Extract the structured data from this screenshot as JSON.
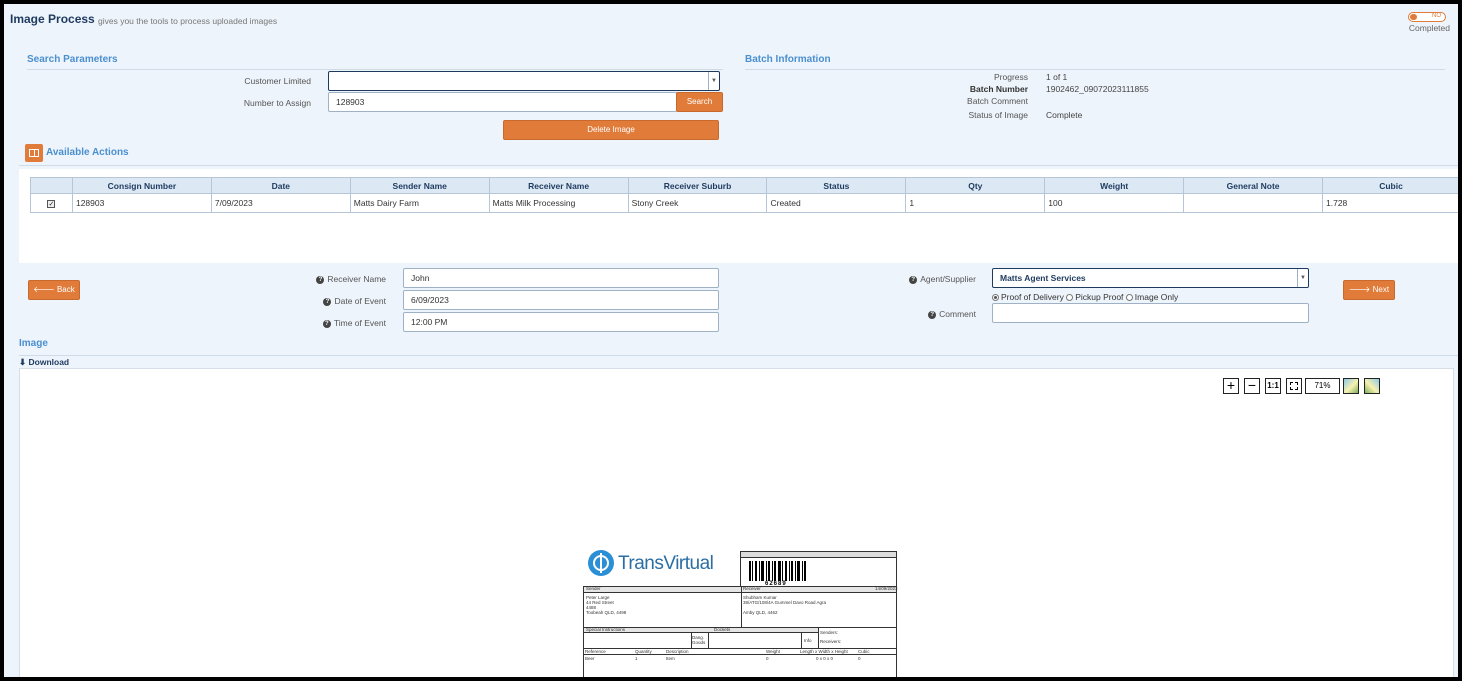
{
  "header": {
    "title": "Image Process",
    "subtitle": "gives you the tools to process uploaded images",
    "skip_line1": "Skip",
    "skip_line2": "Completed",
    "toggle_state": "NO"
  },
  "search": {
    "section_title": "Search Parameters",
    "customer_label": "Customer Limited",
    "customer_value": "",
    "number_label": "Number to Assign",
    "number_value": "128903",
    "search_button": "Search",
    "delete_button": "Delete Image"
  },
  "batch": {
    "section_title": "Batch Information",
    "progress_label": "Progress",
    "progress_value": "1 of 1",
    "batch_number_label": "Batch Number",
    "batch_number_value": "1902462_09072023111855",
    "batch_comment_label": "Batch Comment",
    "batch_comment_value": "",
    "status_label": "Status of Image",
    "status_value": "Complete"
  },
  "actions": {
    "section_title": "Available Actions",
    "columns": [
      "Consign Number",
      "Date",
      "Sender Name",
      "Receiver Name",
      "Receiver Suburb",
      "Status",
      "Qty",
      "Weight",
      "General Note",
      "Cubic"
    ],
    "rows": [
      {
        "checked": true,
        "cells": [
          "128903",
          "7/09/2023",
          "Matts Dairy Farm",
          "Matts Milk Processing",
          "Stony Creek",
          "Created",
          "1",
          "100",
          "",
          "1.728"
        ]
      }
    ]
  },
  "event": {
    "back_button": "Back",
    "next_button": "Next",
    "receiver_name_label": "Receiver Name",
    "receiver_name_value": "John",
    "date_label": "Date of Event",
    "date_value": "6/09/2023",
    "time_label": "Time of Event",
    "time_value": "12:00 PM",
    "agent_label": "Agent/Supplier",
    "agent_value": "Matts Agent Services",
    "radio_options": [
      "Proof of Delivery",
      "Pickup Proof",
      "Image Only"
    ],
    "radio_selected": "Proof of Delivery",
    "comment_label": "Comment",
    "comment_value": ""
  },
  "image": {
    "section_title": "Image",
    "download_label": "Download",
    "zoom_level": "71%",
    "toolbar_icons": [
      "zoom-in-icon",
      "zoom-out-icon",
      "actual-size-icon",
      "fit-icon",
      "rotate-left-icon",
      "rotate-right-icon"
    ],
    "one_to_one_label": "1:1"
  },
  "document": {
    "logo_text": "TransVirtual",
    "barcode_number": "62689",
    "sender_header": "Sender",
    "receiver_header": "Receiver",
    "receiver_date": "14/09/2023",
    "sender_address": [
      "Peter Large",
      "44 Red Street",
      "4488",
      "Toobeah QLD, 4498"
    ],
    "receiver_address": [
      "Shubham Kumar",
      "38/ATG/108/4A Gummel Davo Road Agra",
      "",
      "Amby QLD, 4462"
    ],
    "special_instructions_label": "Special Instructions",
    "dockets_label": "Dockets",
    "dang_goods_label": "Dang. Goods",
    "info_label": "Info",
    "senders_label": "Senders:",
    "receivers_label": "Receivers:",
    "item_columns": [
      "Reference",
      "Quantity",
      "Description",
      "Weight",
      "Length x Width x Height",
      "Cubic"
    ],
    "item_row": [
      "Beer",
      "1",
      "Item",
      "0",
      "0 x 0 x 0",
      "0"
    ]
  },
  "colors": {
    "accent": "#e07b39",
    "section_blue": "#4a8fd0",
    "navy": "#1e3a5f",
    "background": "#eef4fb"
  }
}
